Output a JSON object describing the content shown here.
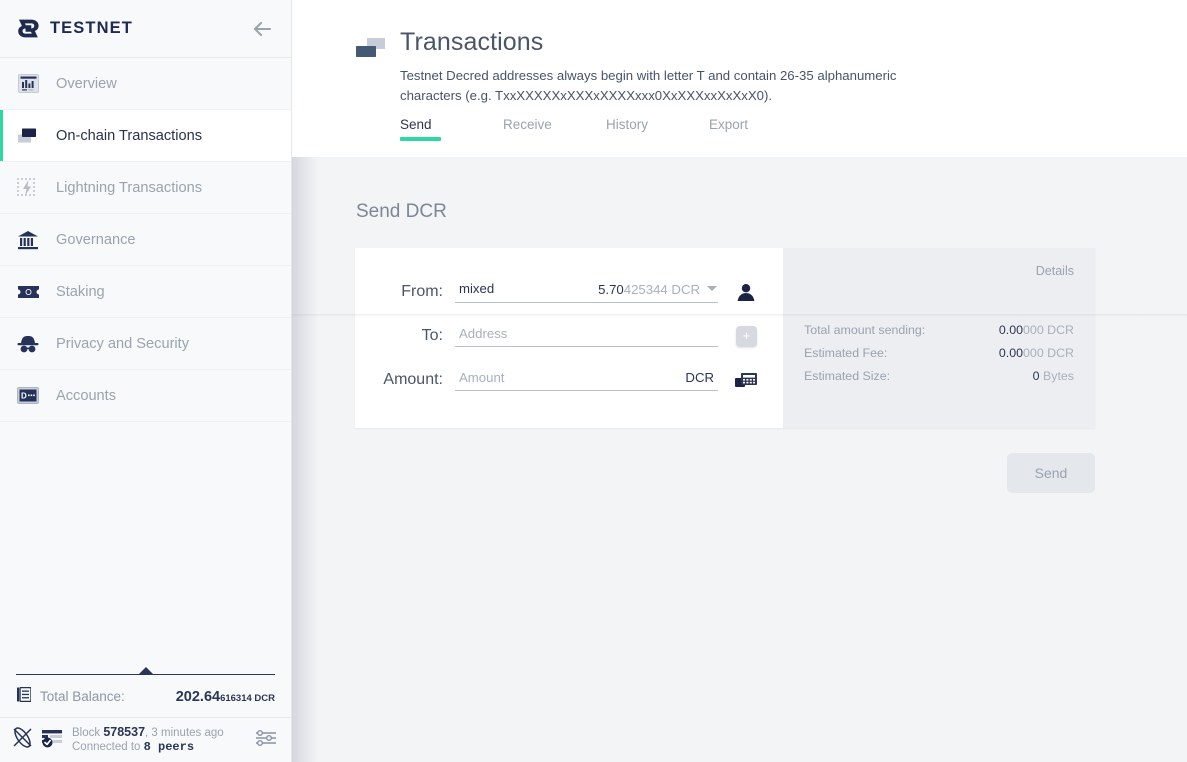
{
  "sidebar": {
    "brand": "TESTNET",
    "back_icon": "arrow-left-icon",
    "items": [
      {
        "label": "Overview",
        "icon": "chart-bars-icon",
        "active": false
      },
      {
        "label": "On-chain Transactions",
        "icon": "transactions-icon",
        "active": true
      },
      {
        "label": "Lightning Transactions",
        "icon": "lightning-icon",
        "active": false
      },
      {
        "label": "Governance",
        "icon": "bank-icon",
        "active": false
      },
      {
        "label": "Staking",
        "icon": "ticket-icon",
        "active": false
      },
      {
        "label": "Privacy and Security",
        "icon": "incognito-icon",
        "active": false
      },
      {
        "label": "Accounts",
        "icon": "accounts-icon",
        "active": false
      }
    ],
    "balance": {
      "icon": "ledger-icon",
      "label": "Total Balance:",
      "value_major": "202.64",
      "value_minor": "616314 DCR"
    },
    "status": {
      "sync_icon": "decred-sync-icon",
      "block_icon": "block-checked-icon",
      "block_label": "Block",
      "block_number": "578537",
      "block_age": ", 3 minutes ago",
      "peers_label": "Connected to",
      "peers_value": "8 peers",
      "settings_icon": "sliders-icon"
    }
  },
  "header": {
    "icon": "transactions-page-icon",
    "title": "Transactions",
    "subtitle": "Testnet Decred addresses always begin with letter T and contain 26-35 alphanumeric characters (e.g. TxxXXXXXxXXXxXXXXxxx0XxXXXxxXxXxX0).",
    "tabs": [
      {
        "label": "Send",
        "active": true
      },
      {
        "label": "Receive",
        "active": false
      },
      {
        "label": "History",
        "active": false
      },
      {
        "label": "Export",
        "active": false
      }
    ],
    "accent_color": "#2ed8a3"
  },
  "send_form": {
    "section_title": "Send DCR",
    "from": {
      "label": "From:",
      "account": "mixed",
      "balance_major": "5.70",
      "balance_minor": "425344 DCR",
      "caret_icon": "chevron-down-icon",
      "avatar_icon": "account-avatar-icon"
    },
    "to": {
      "label": "To:",
      "placeholder": "Address",
      "value": "",
      "add_button_label": "+",
      "add_button_icon": "plus-icon"
    },
    "amount": {
      "label": "Amount:",
      "placeholder": "Amount",
      "value": "",
      "unit": "DCR",
      "calculator_icon": "keyboard-calculator-icon"
    },
    "submit_label": "Send"
  },
  "details": {
    "title": "Details",
    "rows": [
      {
        "label": "Total amount sending:",
        "value_major": "0.00",
        "value_minor": "000 DCR"
      },
      {
        "label": "Estimated Fee:",
        "value_major": "0.00",
        "value_minor": "000 DCR"
      },
      {
        "label": "Estimated Size:",
        "value_major": "0",
        "value_minor": " Bytes"
      }
    ]
  }
}
